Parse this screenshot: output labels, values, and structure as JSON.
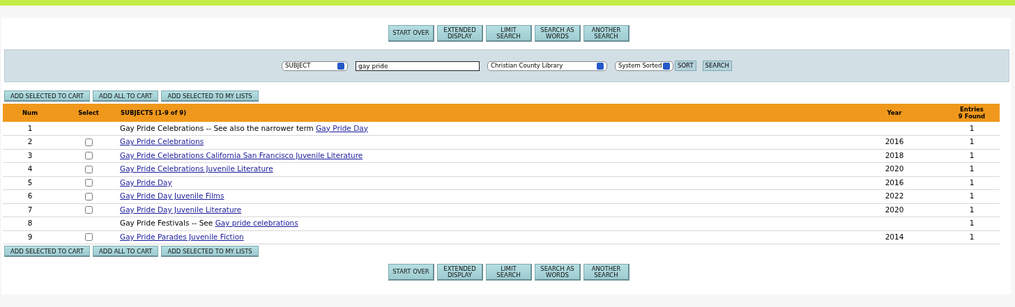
{
  "nav_buttons_top": [
    "START OVER",
    "EXTENDED\nDISPLAY",
    "LIMIT\nSEARCH",
    "SEARCH AS\nWORDS",
    "ANOTHER\nSEARCH"
  ],
  "search": {
    "index": "SUBJECT",
    "query": "gay pride",
    "library": "Christian County Library",
    "sort": "System Sorted",
    "sort_button": "SORT",
    "search_button": "SEARCH"
  },
  "cart_buttons_top": [
    "ADD SELECTED TO CART",
    "ADD ALL TO CART",
    "ADD SELECTED TO MY LISTS"
  ],
  "table": {
    "columns": [
      "Num",
      "Select",
      "SUBJECTS (1-9 of 9)",
      "Year",
      "Entries\n9 Found"
    ],
    "rows": [
      {
        "num": "1",
        "text": "Gay Pride Celebrations -- See also the narrower term",
        "link": "Gay Pride Day",
        "year": "",
        "entries": "1"
      },
      {
        "num": "2",
        "checked": false,
        "link": "Gay Pride Celebrations",
        "year": "2016",
        "entries": "1"
      },
      {
        "num": "3",
        "checked": false,
        "link": "Gay Pride Celebrations California San Francisco Juvenile Literature",
        "year": "2018",
        "entries": "1"
      },
      {
        "num": "4",
        "checked": false,
        "link": "Gay Pride Celebrations Juvenile Literature",
        "year": "2020",
        "entries": "1"
      },
      {
        "num": "5",
        "checked": false,
        "link": "Gay Pride Day",
        "year": "2016",
        "entries": "1"
      },
      {
        "num": "6",
        "checked": false,
        "link": "Gay Pride Day Juvenile Films",
        "year": "2022",
        "entries": "1"
      },
      {
        "num": "7",
        "checked": false,
        "link": "Gay Pride Day Juvenile Literature",
        "year": "2020",
        "entries": "1"
      },
      {
        "num": "8",
        "text": "Gay Pride Festivals -- See",
        "link": "Gay pride celebrations",
        "year": "",
        "entries": "1"
      },
      {
        "num": "9",
        "checked": false,
        "link": "Gay Pride Parades Juvenile Fiction",
        "year": "2014",
        "entries": "1"
      }
    ]
  },
  "cart_buttons_bottom": [
    "ADD SELECTED TO CART",
    "ADD ALL TO CART",
    "ADD SELECTED TO MY LISTS"
  ],
  "nav_buttons_bottom": [
    "START OVER",
    "EXTENDED\nDISPLAY",
    "LIMIT\nSEARCH",
    "SEARCH AS\nWORDS",
    "ANOTHER\nSEARCH"
  ]
}
